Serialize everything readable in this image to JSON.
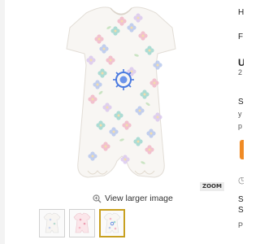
{
  "product": {
    "image_alt": "Floral print baby romper",
    "view_larger_label": "View larger image",
    "zoom_label": "ZOOM",
    "thumbnails": [
      {
        "name": "thumb-white-floral",
        "selected": false
      },
      {
        "name": "thumb-pink-floral",
        "selected": false
      },
      {
        "name": "thumb-multicolor-floral",
        "selected": true
      }
    ]
  },
  "right_panel": {
    "line1": "H",
    "line2": "F",
    "line3": "U",
    "line3b": "2",
    "line4": "S",
    "line4b": "y",
    "line4c": "p",
    "line5": "S",
    "line5b": "S",
    "line5c": "P"
  },
  "colors": {
    "accent_button": "#f08a24",
    "selected_thumb_border": "#c8a020"
  }
}
